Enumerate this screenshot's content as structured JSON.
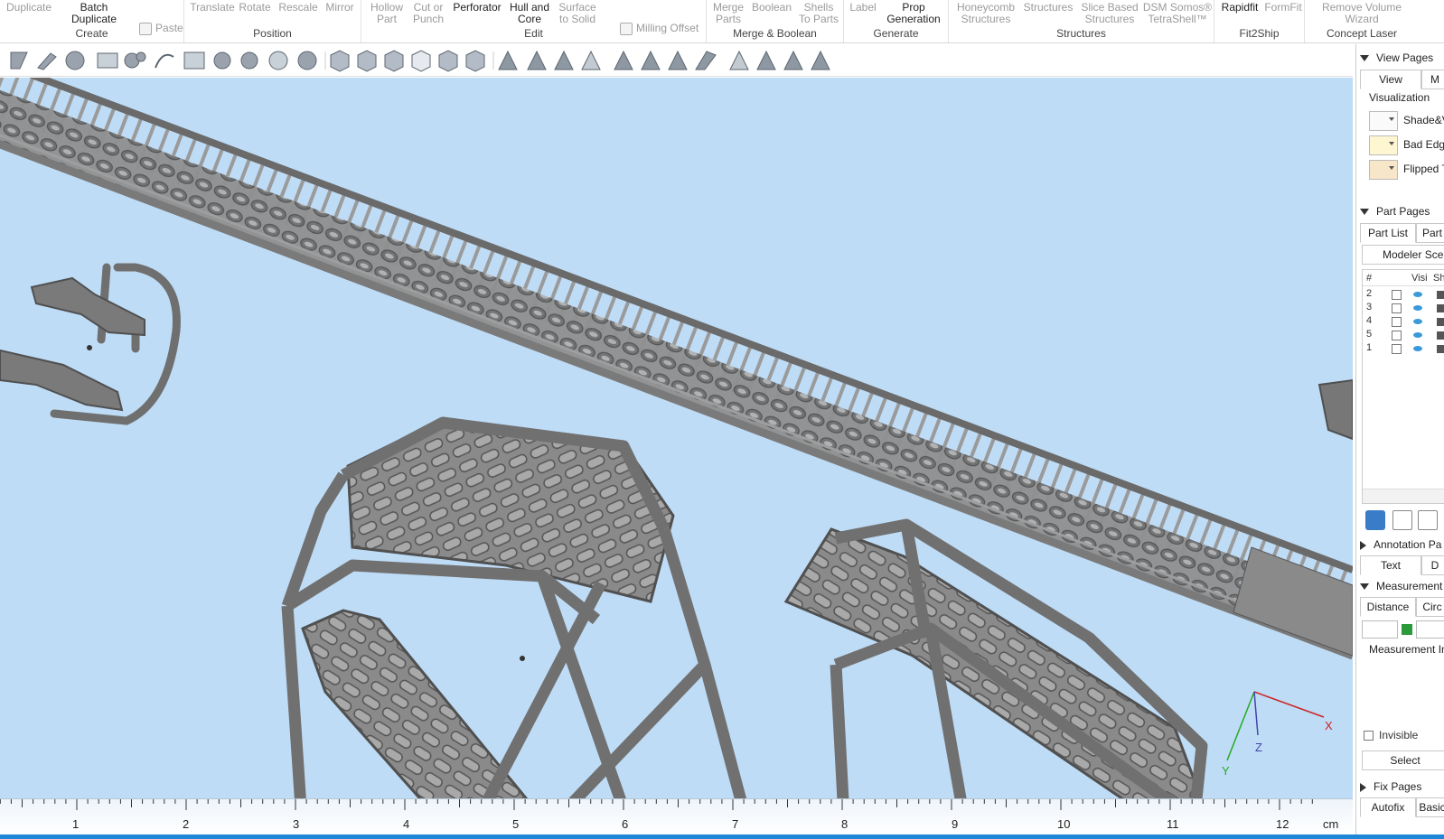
{
  "ribbon": {
    "create": {
      "label": "Create",
      "duplicate": "Duplicate",
      "batch_duplicate": "Batch\nDuplicate",
      "paste": "Paste"
    },
    "position": {
      "label": "Position",
      "translate": "Translate",
      "rotate": "Rotate",
      "rescale": "Rescale",
      "mirror": "Mirror"
    },
    "edit": {
      "label": "Edit",
      "hollow_part": "Hollow\nPart",
      "cut_or_punch": "Cut or\nPunch",
      "perforator": "Perforator",
      "hull_and_core": "Hull and\nCore",
      "surface_to_solid": "Surface\nto Solid",
      "milling_offset": "Milling Offset"
    },
    "merge": {
      "label": "Merge & Boolean",
      "merge_parts": "Merge\nParts",
      "boolean": "Boolean",
      "shells_to_parts": "Shells\nTo Parts"
    },
    "generate": {
      "label": "Generate",
      "label_btn": "Label",
      "prop_generation": "Prop\nGeneration"
    },
    "structures": {
      "label": "Structures",
      "honeycomb": "Honeycomb\nStructures",
      "structures": "Structures",
      "slice_based": "Slice Based\nStructures",
      "dsm_somos": "DSM Somos®\nTetraShell™"
    },
    "fit2ship": {
      "label": "Fit2Ship",
      "rapidfit": "Rapidfit",
      "formfit": "FormFit"
    },
    "concept_laser": {
      "label": "Concept Laser",
      "remove_volume": "Remove Volume\nWizard"
    }
  },
  "panel": {
    "view_pages": "View Pages",
    "view_tab": "View",
    "view_tab2": "M",
    "visualization": "Visualization",
    "viz_items": [
      "Shade&V",
      "Bad Edg",
      "Flipped T"
    ],
    "part_pages": "Part Pages",
    "part_list_tab": "Part List",
    "part_tab2": "Part",
    "scene_dropdown": "Modeler Scen",
    "list_headers": {
      "num": "#",
      "visible": "Visi",
      "shade": "Sh"
    },
    "part_rows": [
      "2",
      "3",
      "4",
      "5",
      "1"
    ],
    "annotation_pages": "Annotation Pa",
    "text_tab": "Text",
    "d_tab": "D",
    "measurement": "Measurement",
    "distance_tab": "Distance",
    "circle_tab": "Circ",
    "measurement_info": "Measurement Inf",
    "invisible": "Invisible",
    "select_btn": "Select",
    "fix_pages": "Fix Pages",
    "autofix_tab": "Autofix",
    "basic_tab": "Basic"
  },
  "ruler": {
    "numbers": [
      "1",
      "2",
      "3",
      "4",
      "5",
      "6",
      "7",
      "8",
      "9",
      "10",
      "11",
      "12"
    ],
    "unit": "cm"
  },
  "axes": {
    "x": "X",
    "y": "Y",
    "z": "Z"
  },
  "colors": {
    "viewport_bg": "#bfdcf6",
    "model": "#8d8d8d",
    "status_bar": "#1e88d8"
  }
}
